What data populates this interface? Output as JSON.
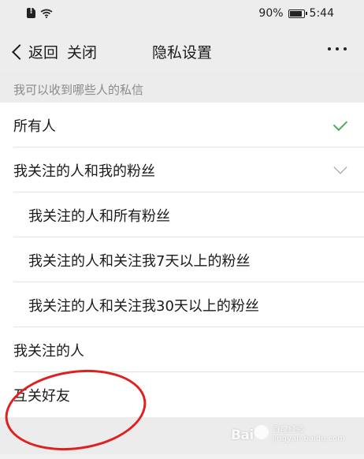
{
  "status_bar": {
    "battery_percent": "90%",
    "battery_level": 0.9,
    "time": "5:44",
    "icons": [
      "sim-alert-icon",
      "wifi-icon",
      "battery-icon"
    ]
  },
  "header": {
    "back_label": "返回",
    "close_label": "关闭",
    "title": "隐私设置",
    "more_icon": "more-dots-icon"
  },
  "section": {
    "label": "我可以收到哪些人的私信"
  },
  "options": [
    {
      "label": "所有人",
      "level": 1,
      "state": "checked",
      "icon": "check-icon"
    },
    {
      "label": "我关注的人和我的粉丝",
      "level": 1,
      "state": "expandable",
      "icon": "chevron-down-icon"
    },
    {
      "label": "我关注的人和所有粉丝",
      "level": 2
    },
    {
      "label": "我关注的人和关注我7天以上的粉丝",
      "level": 2
    },
    {
      "label": "我关注的人和关注我30天以上的粉丝",
      "level": 2
    },
    {
      "label": "我关注的人",
      "level": 1
    },
    {
      "label": "互关好友",
      "level": 1
    }
  ],
  "colors": {
    "check": "#4cae5c",
    "annotation": "#e02020",
    "section_text": "#8a8a8a"
  },
  "watermark": {
    "logo_prefix": "Bai",
    "logo_suffix": "百度",
    "sub": "经验",
    "url": "jingyan.baidu.com"
  }
}
